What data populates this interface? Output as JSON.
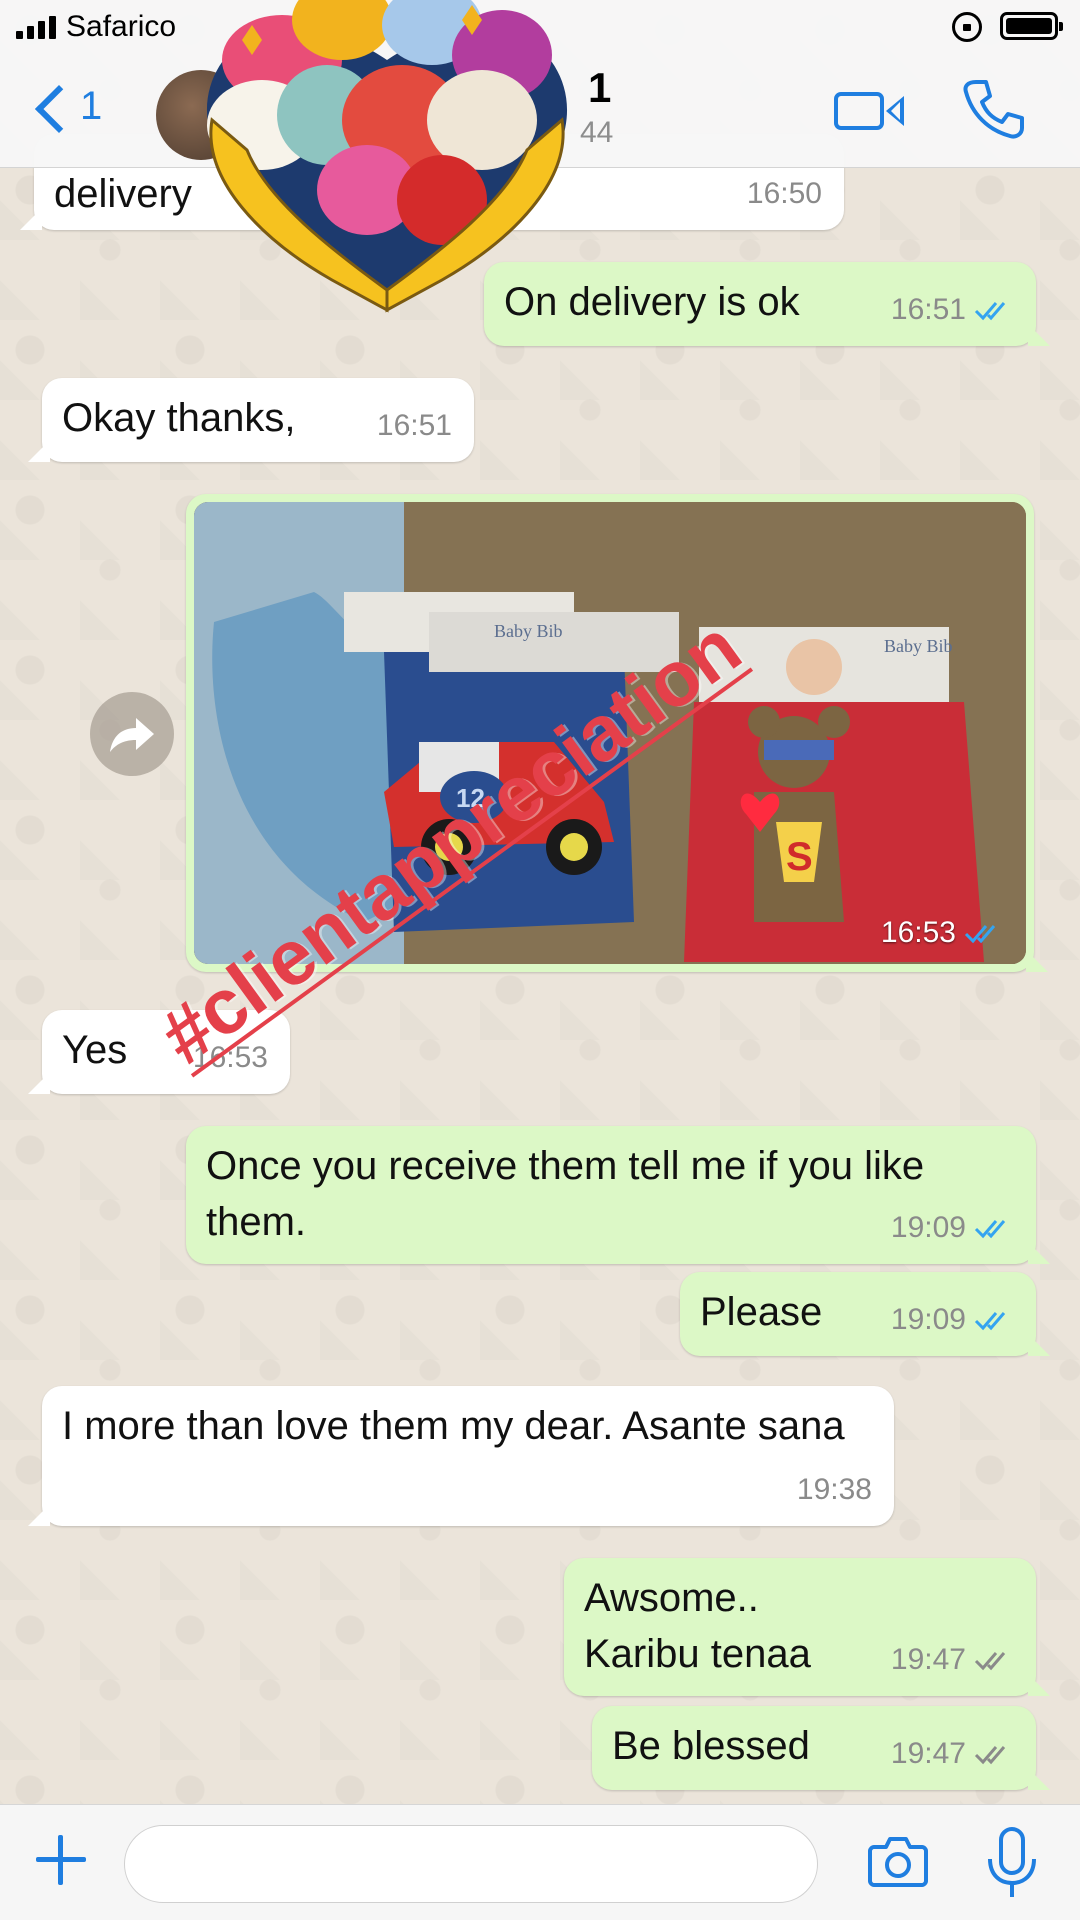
{
  "status_bar": {
    "carrier": "Safarico"
  },
  "header": {
    "back_count": "1",
    "contact_name": "1",
    "contact_sub": "44"
  },
  "messages": [
    {
      "direction": "in",
      "text": "delivery",
      "time": "16:50"
    },
    {
      "direction": "out",
      "text": "On delivery is ok",
      "time": "16:51",
      "ticks": "read"
    },
    {
      "direction": "in",
      "text": "Okay thanks,",
      "time": "16:51"
    },
    {
      "direction": "out",
      "type": "photo",
      "time": "16:53",
      "ticks": "read",
      "photo_labels": [
        "Baby Bib",
        "12",
        "S"
      ]
    },
    {
      "direction": "in",
      "text": "Yes",
      "time": "16:53"
    },
    {
      "direction": "out",
      "text": "Once you receive them tell me if you like them.",
      "time": "19:09",
      "ticks": "read"
    },
    {
      "direction": "out",
      "text": "Please",
      "time": "19:09",
      "ticks": "read"
    },
    {
      "direction": "in",
      "text": "I more than love them my dear. Asante sana",
      "time": "19:38"
    },
    {
      "direction": "out",
      "text": "Awsome..\nKaribu tenaa",
      "time": "19:47",
      "ticks": "delivered"
    },
    {
      "direction": "out",
      "text": "Be blessed",
      "time": "19:47",
      "ticks": "delivered"
    }
  ],
  "overlay": {
    "hashtag": "#clientappreciation"
  },
  "input_bar": {
    "placeholder": ""
  },
  "colors": {
    "accent": "#1f7ee0",
    "outgoing_bubble": "#dcf8c6",
    "incoming_bubble": "#ffffff",
    "read_tick": "#34a4f0",
    "delivered_tick": "#8a8a8a",
    "hashtag": "#e4404a"
  },
  "icons": [
    "back-chevron-icon",
    "video-call-icon",
    "phone-icon",
    "forward-icon",
    "plus-icon",
    "camera-icon",
    "microphone-icon",
    "read-receipt-icon"
  ]
}
